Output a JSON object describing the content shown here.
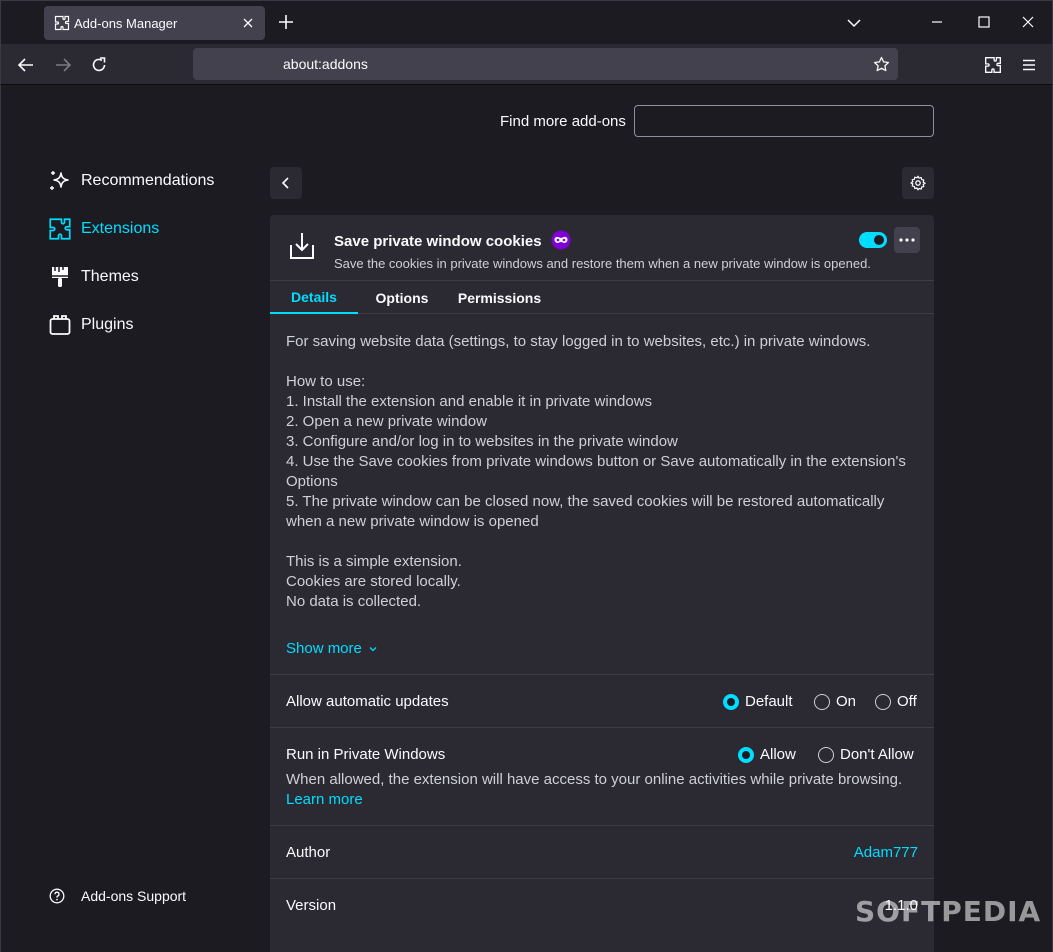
{
  "browser": {
    "tab_title": "Add-ons Manager",
    "url": "about:addons"
  },
  "search": {
    "label": "Find more add-ons",
    "value": "",
    "placeholder": ""
  },
  "sidebar": {
    "items": [
      {
        "label": "Recommendations",
        "icon": "sparkle-icon",
        "active": false
      },
      {
        "label": "Extensions",
        "icon": "puzzle-icon",
        "active": true
      },
      {
        "label": "Themes",
        "icon": "brush-icon",
        "active": false
      },
      {
        "label": "Plugins",
        "icon": "plugin-icon",
        "active": false
      }
    ],
    "support_label": "Add-ons Support"
  },
  "addon": {
    "name": "Save private window cookies",
    "description": "Save the cookies in private windows and restore them when a new private window is opened.",
    "enabled": true,
    "tabs": [
      "Details",
      "Options",
      "Permissions"
    ],
    "active_tab": "Details",
    "details": [
      "For saving website data (settings, to stay logged in to websites, etc.) in private windows.",
      "",
      "How to use:",
      "1. Install the extension and enable it in private windows",
      "2. Open a new private window",
      "3. Configure and/or log in to websites in the private window",
      "4. Use the Save cookies from private windows button or Save automatically in the extension's Options",
      "5. The private window can be closed now, the saved cookies will be restored automatically when a new private window is opened",
      "",
      "This is a simple extension.",
      "Cookies are stored locally.",
      "No data is collected."
    ],
    "show_more": "Show more",
    "updates": {
      "label": "Allow automatic updates",
      "options": [
        "Default",
        "On",
        "Off"
      ],
      "selected": "Default"
    },
    "private": {
      "label": "Run in Private Windows",
      "options": [
        "Allow",
        "Don't Allow"
      ],
      "selected": "Allow",
      "note": "When allowed, the extension will have access to your online activities while private browsing.",
      "learn_more": "Learn more"
    },
    "author": {
      "label": "Author",
      "value": "Adam777"
    },
    "version": {
      "label": "Version",
      "value": "1.1.0"
    }
  },
  "watermark": "SOFTPEDIA",
  "colors": {
    "accent": "#00ddff",
    "background": "#1c1b22",
    "card": "#2b2a33"
  }
}
